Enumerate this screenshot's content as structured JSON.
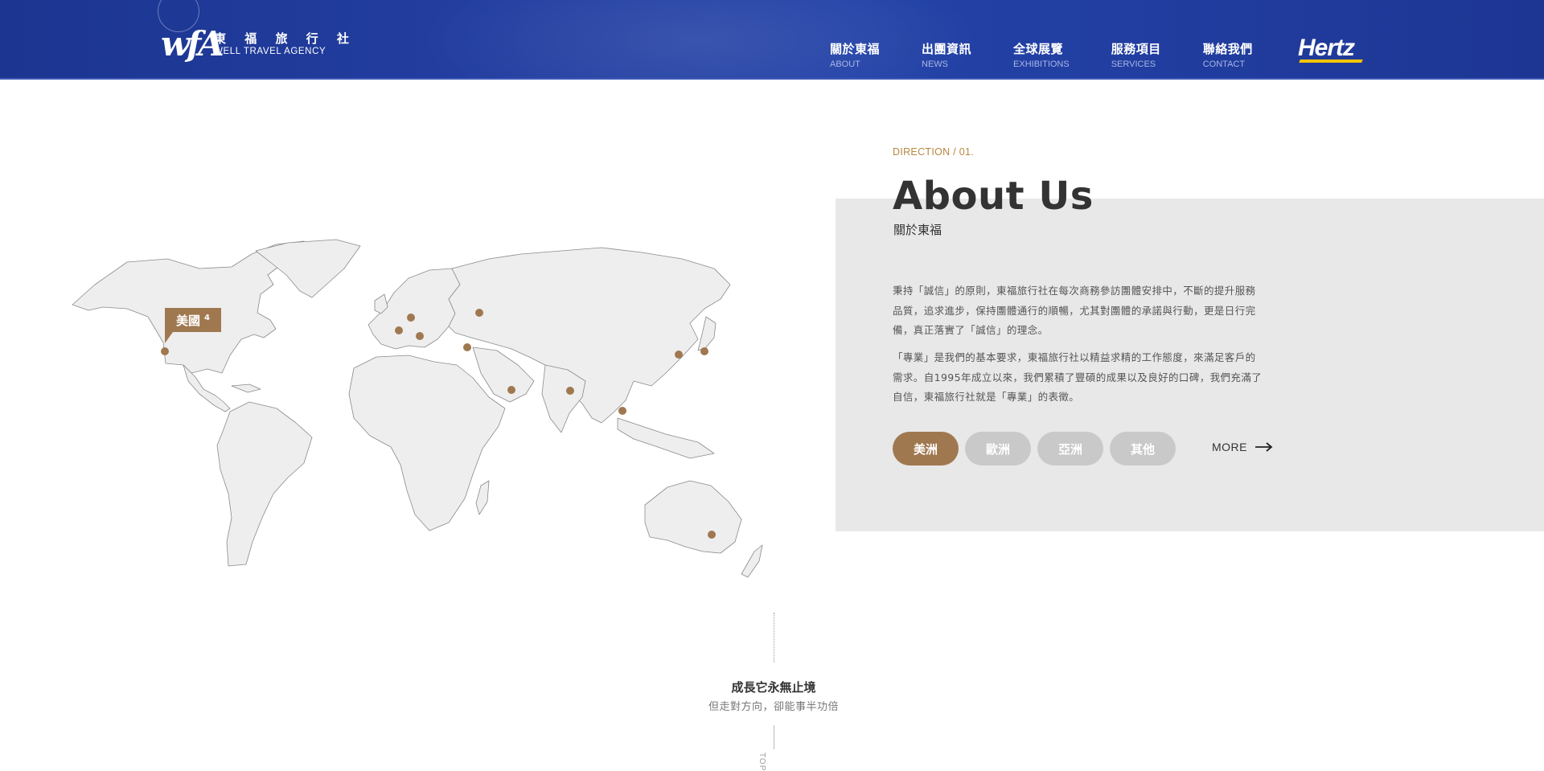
{
  "header": {
    "logo": {
      "mark": "wfA",
      "name_zh": "東 福 旅 行 社",
      "name_en": "WELL TRAVEL AGENCY"
    },
    "nav": [
      {
        "zh": "關於東福",
        "en": "ABOUT"
      },
      {
        "zh": "出團資訊",
        "en": "NEWS"
      },
      {
        "zh": "全球展覽",
        "en": "EXHIBITIONS"
      },
      {
        "zh": "服務項目",
        "en": "SERVICES"
      },
      {
        "zh": "聯絡我們",
        "en": "CONTACT"
      }
    ],
    "partner_logo": "Hertz"
  },
  "about": {
    "direction": "DIRECTION / 01.",
    "title": "About Us",
    "subtitle": "關於東福",
    "paragraph1": "秉持「誠信」的原則，東福旅行社在每次商務參訪團體安排中，不斷的提升服務品質，追求進步，保持團體通行的順暢，尤其對團體的承諾與行動，更是日行完備，真正落實了「誠信」的理念。",
    "paragraph2": "「專業」是我們的基本要求，東福旅行社以精益求精的工作態度，來滿足客戶的需求。自1995年成立以來，我們累積了豐碩的成果以及良好的口碑，我們充滿了自信，東福旅行社就是「專業」的表徵。",
    "regions": [
      "美洲",
      "歐洲",
      "亞洲",
      "其他"
    ],
    "active_region": "美洲",
    "more_label": "MORE"
  },
  "map": {
    "tooltip_label": "美國",
    "tooltip_count": "4",
    "marker_color": "#a07850",
    "land_color": "#eeeeee"
  },
  "slogan": {
    "main": "成長它永無止境",
    "sub": "但走對方向，卻能事半功倍",
    "scroll": "TOP"
  },
  "colors": {
    "header_blue": "#1c3591",
    "accent_brown": "#a07850",
    "direction_gold": "#b8873f",
    "panel_grey": "#e8e8e8"
  }
}
